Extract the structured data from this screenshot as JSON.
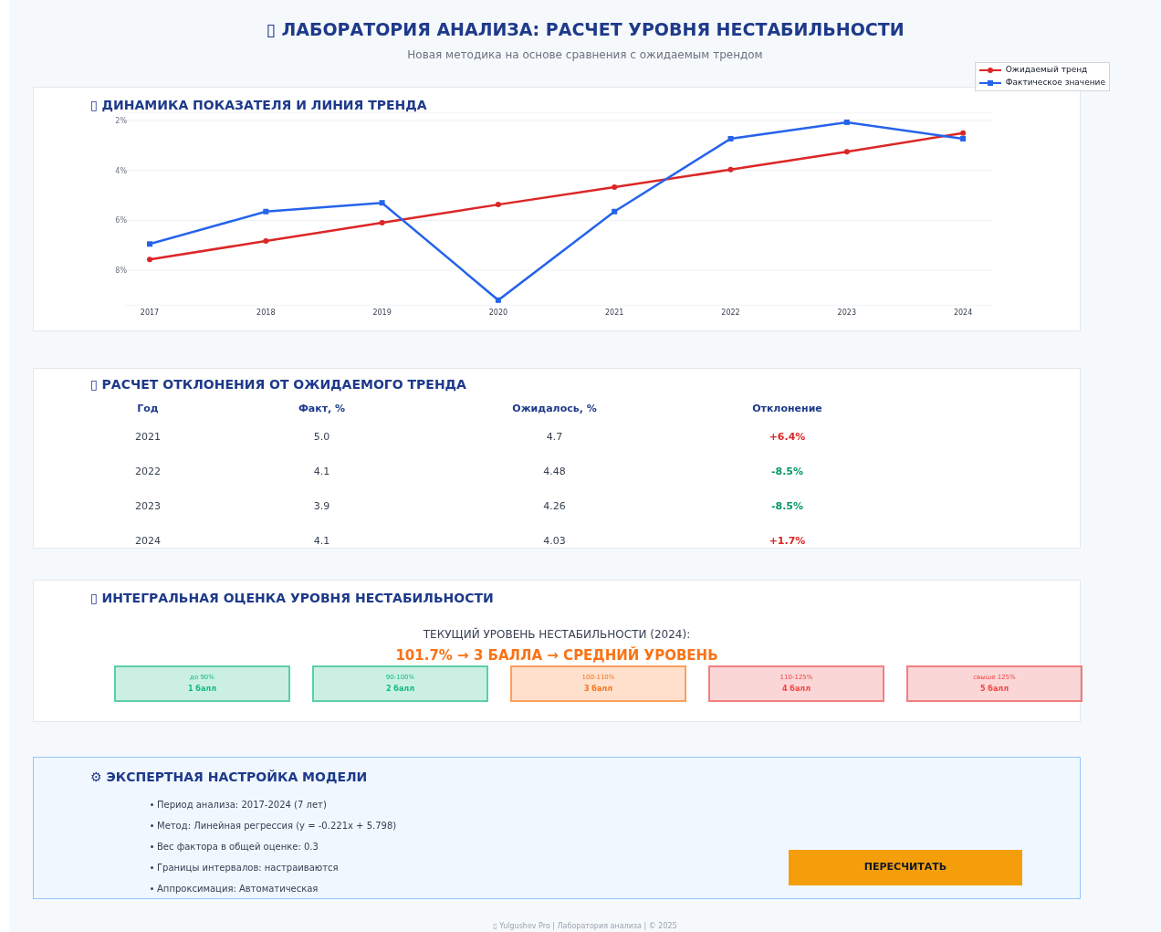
{
  "header": {
    "title": "▯ ЛАБОРАТОРИЯ АНАЛИЗА: РАСЧЕТ УРОВНЯ НЕСТАБИЛЬНОСТИ",
    "subtitle": "Новая методика на основе сравнения с ожидаемым трендом"
  },
  "trend_chart": {
    "title": "▯ ДИНАМИКА ПОКАЗАТЕЛЯ И ЛИНИЯ ТРЕНДА",
    "chart_data": {
      "type": "line",
      "categories": [
        "2017",
        "2018",
        "2019",
        "2020",
        "2021",
        "2022",
        "2023",
        "2024"
      ],
      "grid": true,
      "ylim": [
        9.4,
        1.7
      ],
      "yticks": [
        {
          "value": 2,
          "label": "2%"
        },
        {
          "value": 4,
          "label": "4%"
        },
        {
          "value": 6,
          "label": "6%"
        },
        {
          "value": 8,
          "label": "8%"
        }
      ],
      "series": [
        {
          "name": "Ожидаемый тренд",
          "color": "#dc2626",
          "marker": "circle",
          "values": [
            7.57,
            6.83,
            6.1,
            5.37,
            4.67,
            3.97,
            3.25,
            2.5
          ]
        },
        {
          "name": "Фактическое значение",
          "color": "#2563eb",
          "marker": "square",
          "values": [
            6.95,
            5.65,
            5.3,
            9.2,
            5.65,
            2.73,
            2.07,
            2.73
          ]
        }
      ]
    }
  },
  "deviation_table": {
    "title": "▯ РАСЧЕТ ОТКЛОНЕНИЯ ОТ ОЖИДАЕМОГО ТРЕНДА",
    "columns": [
      "Год",
      "Факт, %",
      "Ожидалось, %",
      "Отклонение"
    ],
    "rows": [
      {
        "year": "2021",
        "fact": "5.0",
        "expected": "4.7",
        "deviation": "+6.4%",
        "color": "#dc2626"
      },
      {
        "year": "2022",
        "fact": "4.1",
        "expected": "4.48",
        "deviation": "-8.5%",
        "color": "#059669"
      },
      {
        "year": "2023",
        "fact": "3.9",
        "expected": "4.26",
        "deviation": "-8.5%",
        "color": "#059669"
      },
      {
        "year": "2024",
        "fact": "4.1",
        "expected": "4.03",
        "deviation": "+1.7%",
        "color": "#dc2626"
      }
    ]
  },
  "score": {
    "title": "▯ ИНТЕГРАЛЬНАЯ ОЦЕНКА УРОВНЯ НЕСТАБИЛЬНОСТИ",
    "current_label": "ТЕКУЩИЙ УРОВЕНЬ НЕСТАБИЛЬНОСТИ (2024):",
    "result": "101.7% → 3 БАЛЛА → СРЕДНИЙ УРОВЕНЬ",
    "levels": [
      {
        "range": "до 90%",
        "points": "1 балл",
        "color": "#10b981"
      },
      {
        "range": "90-100%",
        "points": "2 балл",
        "color": "#10b981"
      },
      {
        "range": "100-110%",
        "points": "3 балл",
        "color": "#f97316"
      },
      {
        "range": "110-125%",
        "points": "4 балл",
        "color": "#ef4444"
      },
      {
        "range": "свыше 125%",
        "points": "5 балл",
        "color": "#ef4444"
      }
    ]
  },
  "settings": {
    "title": "⚙ ЭКСПЕРТНАЯ НАСТРОЙКА МОДЕЛИ",
    "items": [
      "Период анализа: 2017-2024 (7 лет)",
      "Метод: Линейная регрессия (y = -0.221x + 5.798)",
      "Вес фактора в общей оценке: 0.3",
      "Границы интервалов: настраиваются",
      "Аппроксимация: Автоматическая"
    ],
    "button": "ПЕРЕСЧИТАТЬ"
  },
  "footer": "▯ Yulgushev Pro | Лаборатория анализа | © 2025"
}
